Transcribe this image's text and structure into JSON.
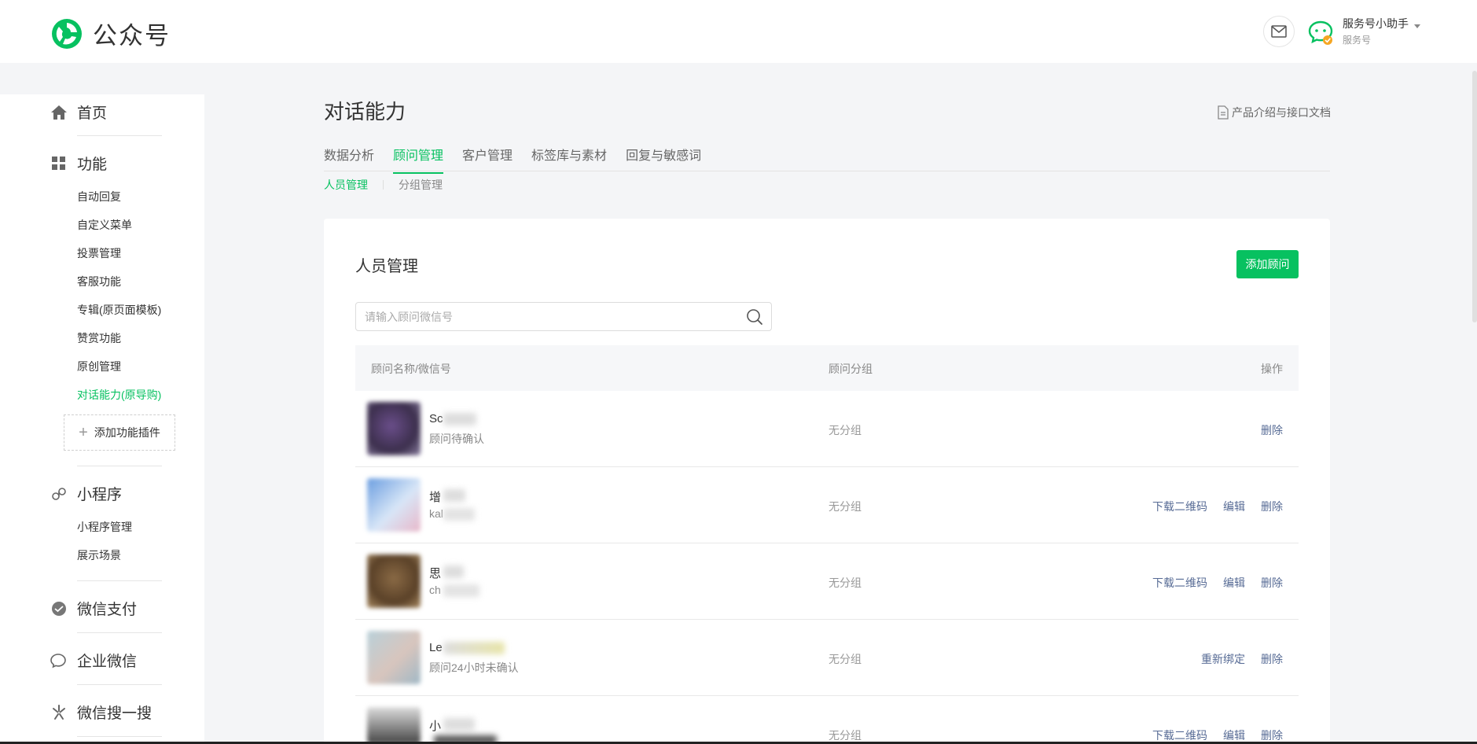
{
  "header": {
    "logo_text": "公众号",
    "account_name": "服务号小助手",
    "account_type": "服务号"
  },
  "sidebar": {
    "home": "首页",
    "features": "功能",
    "feature_items": [
      "自动回复",
      "自定义菜单",
      "投票管理",
      "客服功能",
      "专辑(原页面模板)",
      "赞赏功能",
      "原创管理",
      "对话能力(原导购)"
    ],
    "add_plugin": "添加功能插件",
    "miniprogram": "小程序",
    "miniprogram_items": [
      "小程序管理",
      "展示场景"
    ],
    "wechat_pay": "微信支付",
    "work_wechat": "企业微信",
    "wechat_search": "微信搜一搜"
  },
  "main": {
    "title": "对话能力",
    "doc_link": "产品介绍与接口文档",
    "tabs": [
      "数据分析",
      "顾问管理",
      "客户管理",
      "标签库与素材",
      "回复与敏感词"
    ],
    "subtabs": [
      "人员管理",
      "分组管理"
    ],
    "card_title": "人员管理",
    "add_button": "添加顾问",
    "search_placeholder": "请输入顾问微信号",
    "table": {
      "headers": [
        "顾问名称/微信号",
        "顾问分组",
        "操作"
      ],
      "rows": [
        {
          "name": "Sc",
          "sub": "顾问待确认",
          "group": "无分组",
          "ops": [
            "删除"
          ]
        },
        {
          "name": "增",
          "sub": "kal",
          "group": "无分组",
          "ops": [
            "下载二维码",
            "编辑",
            "删除"
          ]
        },
        {
          "name": "思",
          "sub": "ch",
          "group": "无分组",
          "ops": [
            "下载二维码",
            "编辑",
            "删除"
          ]
        },
        {
          "name": "Le",
          "sub": "顾问24小时未确认",
          "group": "无分组",
          "ops": [
            "重新绑定",
            "删除"
          ]
        },
        {
          "name": "小",
          "sub": "",
          "group": "无分组",
          "ops": [
            "下载二维码",
            "编辑",
            "删除"
          ]
        }
      ]
    }
  },
  "colors": {
    "accent": "#07c160",
    "link": "#576b95"
  }
}
